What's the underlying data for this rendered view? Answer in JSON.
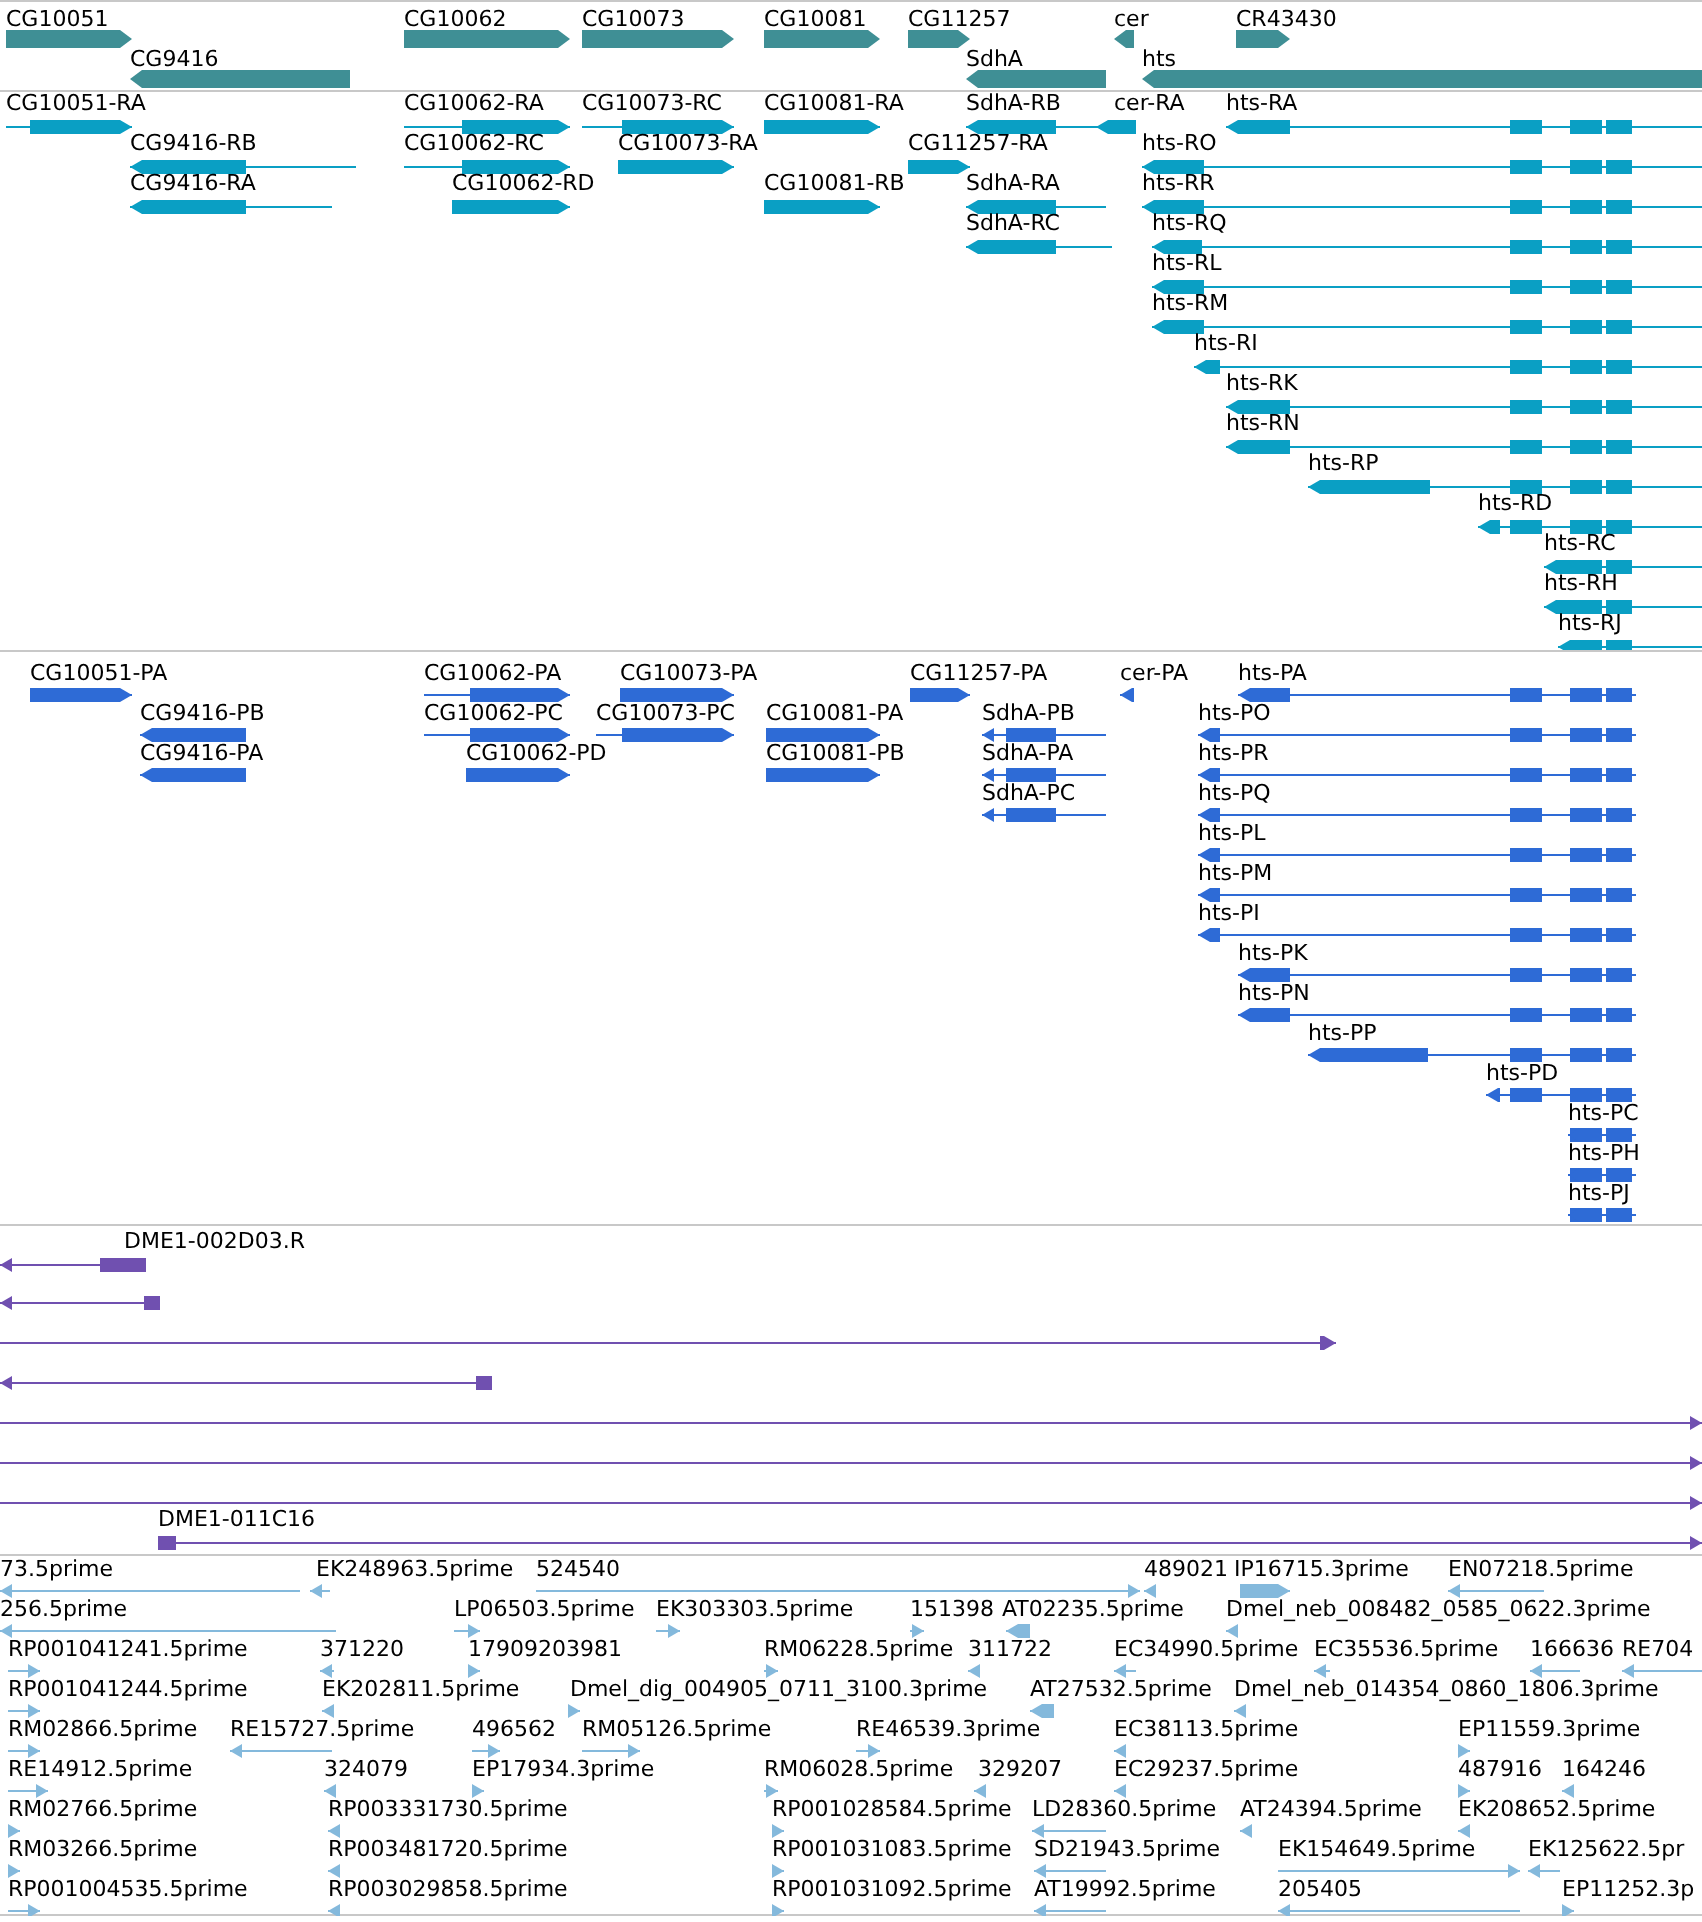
{
  "tracks": [
    {
      "kind": "gene",
      "features": [
        {
          "label": "CG10051",
          "reverse": false
        },
        {
          "label": "CG10062",
          "reverse": false
        },
        {
          "label": "CG10073",
          "reverse": false
        },
        {
          "label": "CG10081",
          "reverse": false
        },
        {
          "label": "CG11257",
          "reverse": false
        },
        {
          "label": "cer",
          "reverse": true
        },
        {
          "label": "CR43430",
          "reverse": false
        },
        {
          "label": "CG9416",
          "reverse": true
        },
        {
          "label": "SdhA",
          "reverse": true
        },
        {
          "label": "hts",
          "reverse": true
        }
      ]
    },
    {
      "kind": "transcript",
      "features": [
        {
          "label": "CG10051-RA",
          "reverse": false
        },
        {
          "label": "CG10062-RA",
          "reverse": false
        },
        {
          "label": "CG10073-RC",
          "reverse": false
        },
        {
          "label": "CG10081-RA",
          "reverse": false
        },
        {
          "label": "SdhA-RB",
          "reverse": true
        },
        {
          "label": "cer-RA",
          "reverse": true
        },
        {
          "label": "hts-RA",
          "reverse": true
        },
        {
          "label": "CG9416-RB",
          "reverse": true
        },
        {
          "label": "CG10062-RC",
          "reverse": false
        },
        {
          "label": "CG10073-RA",
          "reverse": false
        },
        {
          "label": "CG11257-RA",
          "reverse": false
        },
        {
          "label": "hts-RO",
          "reverse": true
        },
        {
          "label": "CG9416-RA",
          "reverse": true
        },
        {
          "label": "CG10062-RD",
          "reverse": false
        },
        {
          "label": "CG10081-RB",
          "reverse": false
        },
        {
          "label": "SdhA-RA",
          "reverse": true
        },
        {
          "label": "hts-RR",
          "reverse": true
        },
        {
          "label": "SdhA-RC",
          "reverse": true
        },
        {
          "label": "hts-RQ",
          "reverse": true
        },
        {
          "label": "hts-RL",
          "reverse": true
        },
        {
          "label": "hts-RM",
          "reverse": true
        },
        {
          "label": "hts-RI",
          "reverse": true
        },
        {
          "label": "hts-RK",
          "reverse": true
        },
        {
          "label": "hts-RN",
          "reverse": true
        },
        {
          "label": "hts-RP",
          "reverse": true
        },
        {
          "label": "hts-RD",
          "reverse": true
        },
        {
          "label": "hts-RC",
          "reverse": true
        },
        {
          "label": "hts-RH",
          "reverse": true
        },
        {
          "label": "hts-RJ",
          "reverse": true
        }
      ]
    },
    {
      "kind": "protein",
      "features": [
        {
          "label": "CG10051-PA",
          "reverse": false
        },
        {
          "label": "CG10062-PA",
          "reverse": false
        },
        {
          "label": "CG10073-PA",
          "reverse": false
        },
        {
          "label": "CG11257-PA",
          "reverse": false
        },
        {
          "label": "cer-PA",
          "reverse": true
        },
        {
          "label": "hts-PA",
          "reverse": true
        },
        {
          "label": "CG9416-PB",
          "reverse": true
        },
        {
          "label": "CG10062-PC",
          "reverse": false
        },
        {
          "label": "CG10073-PC",
          "reverse": false
        },
        {
          "label": "CG10081-PA",
          "reverse": false
        },
        {
          "label": "SdhA-PB",
          "reverse": true
        },
        {
          "label": "hts-PO",
          "reverse": true
        },
        {
          "label": "CG9416-PA",
          "reverse": true
        },
        {
          "label": "CG10062-PD",
          "reverse": false
        },
        {
          "label": "CG10081-PB",
          "reverse": false
        },
        {
          "label": "SdhA-PA",
          "reverse": true
        },
        {
          "label": "hts-PR",
          "reverse": true
        },
        {
          "label": "SdhA-PC",
          "reverse": true
        },
        {
          "label": "hts-PQ",
          "reverse": true
        },
        {
          "label": "hts-PL",
          "reverse": true
        },
        {
          "label": "hts-PM",
          "reverse": true
        },
        {
          "label": "hts-PI",
          "reverse": true
        },
        {
          "label": "hts-PK",
          "reverse": true
        },
        {
          "label": "hts-PN",
          "reverse": true
        },
        {
          "label": "hts-PP",
          "reverse": true
        },
        {
          "label": "hts-PD",
          "reverse": true
        },
        {
          "label": "hts-PC",
          "reverse": true
        },
        {
          "label": "hts-PH",
          "reverse": true
        },
        {
          "label": "hts-PJ",
          "reverse": true
        }
      ]
    },
    {
      "kind": "alignment",
      "features": [
        {
          "label": "DME1-002D03.R",
          "reverse": true
        },
        {
          "reverse": true
        },
        {
          "reverse": false
        },
        {
          "reverse": true
        },
        {
          "reverse": false
        },
        {
          "reverse": false
        },
        {
          "reverse": false
        },
        {
          "label": "DME1-011C16",
          "reverse": false
        }
      ]
    },
    {
      "kind": "est",
      "features": [
        {
          "label": "73.5prime",
          "reverse": true
        },
        {
          "label": "EK248963.5prime",
          "reverse": true
        },
        {
          "label": "524540",
          "reverse": false
        },
        {
          "label": "489021",
          "reverse": true
        },
        {
          "label": "IP16715.3prime",
          "reverse": false
        },
        {
          "label": "EN07218.5prime",
          "reverse": true
        },
        {
          "label": "256.5prime",
          "reverse": true
        },
        {
          "label": "LP06503.5prime",
          "reverse": false
        },
        {
          "label": "EK303303.5prime",
          "reverse": false
        },
        {
          "label": "151398",
          "reverse": false
        },
        {
          "label": "AT02235.5prime",
          "reverse": true
        },
        {
          "label": "Dmel_neb_008482_0585_0622.3prime",
          "reverse": true
        },
        {
          "label": "RP001041241.5prime",
          "reverse": false
        },
        {
          "label": "371220",
          "reverse": true
        },
        {
          "label": "17909203981",
          "reverse": false
        },
        {
          "label": "RM06228.5prime",
          "reverse": false
        },
        {
          "label": "311722",
          "reverse": true
        },
        {
          "label": "EC34990.5prime",
          "reverse": true
        },
        {
          "label": "EC35536.5prime",
          "reverse": true
        },
        {
          "label": "166636",
          "reverse": true
        },
        {
          "label": "RE704",
          "reverse": true
        },
        {
          "label": "RP001041244.5prime",
          "reverse": false
        },
        {
          "label": "EK202811.5prime",
          "reverse": true
        },
        {
          "label": "Dmel_dig_004905_0711_3100.3prime",
          "reverse": false
        },
        {
          "label": "AT27532.5prime",
          "reverse": true
        },
        {
          "label": "Dmel_neb_014354_0860_1806.3prime",
          "reverse": true
        },
        {
          "label": "RM02866.5prime",
          "reverse": false
        },
        {
          "label": "RE15727.5prime",
          "reverse": true
        },
        {
          "label": "496562",
          "reverse": false
        },
        {
          "label": "RM05126.5prime",
          "reverse": false
        },
        {
          "label": "RE46539.3prime",
          "reverse": false
        },
        {
          "label": "EC38113.5prime",
          "reverse": true
        },
        {
          "label": "EP11559.3prime",
          "reverse": false
        },
        {
          "label": "RE14912.5prime",
          "reverse": false
        },
        {
          "label": "324079",
          "reverse": true
        },
        {
          "label": "EP17934.3prime",
          "reverse": false
        },
        {
          "label": "RM06028.5prime",
          "reverse": false
        },
        {
          "label": "329207",
          "reverse": true
        },
        {
          "label": "EC29237.5prime",
          "reverse": true
        },
        {
          "label": "487916",
          "reverse": false
        },
        {
          "label": "164246",
          "reverse": true
        },
        {
          "label": "RM02766.5prime",
          "reverse": false
        },
        {
          "label": "RP003331730.5prime",
          "reverse": true
        },
        {
          "label": "RP001028584.5prime",
          "reverse": false
        },
        {
          "label": "LD28360.5prime",
          "reverse": true
        },
        {
          "label": "AT24394.5prime",
          "reverse": true
        },
        {
          "label": "EK208652.5prime",
          "reverse": true
        },
        {
          "label": "RM03266.5prime",
          "reverse": false
        },
        {
          "label": "RP003481720.5prime",
          "reverse": true
        },
        {
          "label": "RP001031083.5prime",
          "reverse": false
        },
        {
          "label": "SD21943.5prime",
          "reverse": true
        },
        {
          "label": "EK154649.5prime",
          "reverse": false
        },
        {
          "label": "EK125622.5pr",
          "reverse": true
        },
        {
          "label": "RP001004535.5prime",
          "reverse": false
        },
        {
          "label": "RP003029858.5prime",
          "reverse": true
        },
        {
          "label": "RP001031092.5prime",
          "reverse": false
        },
        {
          "label": "AT19992.5prime",
          "reverse": true
        },
        {
          "label": "205405",
          "reverse": true
        },
        {
          "label": "EP11252.3p",
          "reverse": false
        }
      ]
    }
  ]
}
